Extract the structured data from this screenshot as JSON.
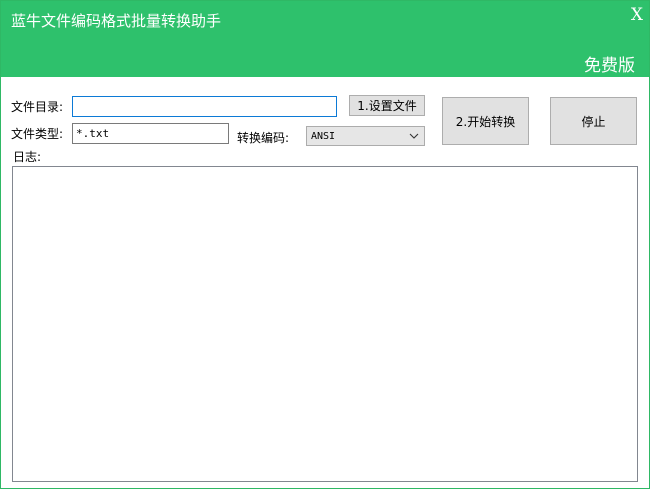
{
  "window": {
    "title": "蓝牛文件编码格式批量转换助手",
    "close_label": "X",
    "edition": "免费版"
  },
  "form": {
    "dir_label": "文件目录:",
    "dir_value": "",
    "set_file_button": "1.设置文件",
    "type_label": "文件类型:",
    "type_value": "*.txt",
    "encoding_label": "转换编码:",
    "encoding_selected": "ANSI",
    "start_button": "2.开始转换",
    "stop_button": "停止",
    "log_label": "日志:",
    "log_text": ""
  },
  "colors": {
    "header_green": "#2ec16c",
    "button_gray": "#e1e1e1"
  },
  "icons": {
    "dropdown": "chevron-down-icon",
    "close": "close-icon"
  }
}
